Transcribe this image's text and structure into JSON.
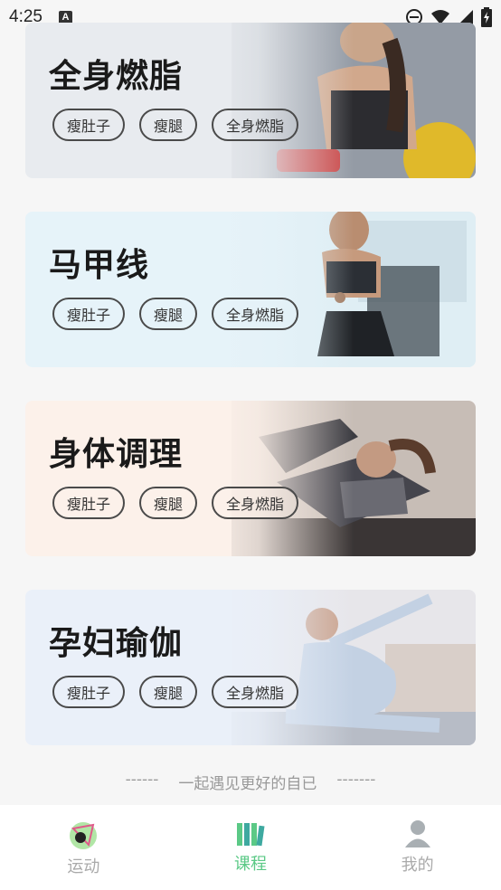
{
  "status_bar": {
    "time": "4:25",
    "notification_icon": "A"
  },
  "cards": [
    {
      "title": "全身燃脂",
      "tags": [
        "瘦肚子",
        "瘦腿",
        "全身燃脂"
      ],
      "bg": "#e8ebef",
      "accent": "#c9cfd8"
    },
    {
      "title": "马甲线",
      "tags": [
        "瘦肚子",
        "瘦腿",
        "全身燃脂"
      ],
      "bg": "#e6f3f9",
      "accent": "#b9d3df"
    },
    {
      "title": "身体调理",
      "tags": [
        "瘦肚子",
        "瘦腿",
        "全身燃脂"
      ],
      "bg": "#fcf1ea",
      "accent": "#8a7f7a"
    },
    {
      "title": "孕妇瑜伽",
      "tags": [
        "瘦肚子",
        "瘦腿",
        "全身燃脂"
      ],
      "bg": "#eaf0f9",
      "accent": "#c8d6e8"
    }
  ],
  "footer_note": {
    "left": "------",
    "text": "一起遇见更好的自已",
    "right": "-------"
  },
  "tabs": [
    {
      "label": "运动",
      "icon": "sport-icon",
      "active": false
    },
    {
      "label": "课程",
      "icon": "books-icon",
      "active": true
    },
    {
      "label": "我的",
      "icon": "profile-icon",
      "active": false
    }
  ],
  "colors": {
    "active_tab": "#5bc986",
    "inactive_tab": "#aaaaaa"
  }
}
